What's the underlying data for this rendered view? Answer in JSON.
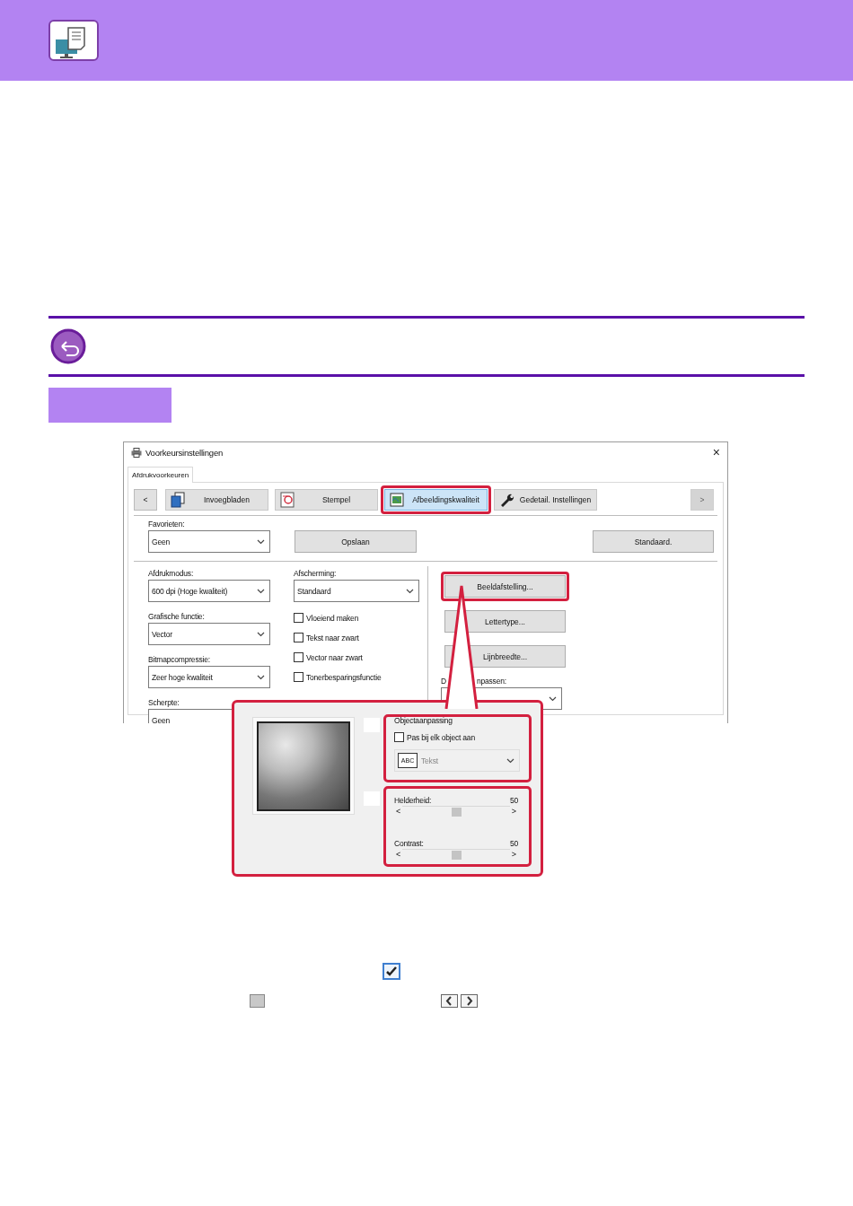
{
  "dialog": {
    "title": "Voorkeursinstellingen",
    "close": "×",
    "tabs": [
      {
        "label": "Afdrukvoorkeuren",
        "selected": true
      }
    ],
    "prev": {
      "label": "<",
      "disabled": false
    },
    "next": {
      "label": ">",
      "disabled": true
    },
    "categories": [
      {
        "label": "Invoegbladen",
        "kind": "pages",
        "selected": false,
        "highlighted": false
      },
      {
        "label": "Stempel",
        "kind": "stamp",
        "selected": false,
        "highlighted": false
      },
      {
        "label": "Afbeeldingskwaliteit",
        "kind": "picture",
        "selected": true,
        "highlighted": true
      },
      {
        "label": "Gedetail. Instellingen",
        "kind": "wrench",
        "selected": false,
        "highlighted": false
      }
    ],
    "favorites": {
      "label": "Favorieten:",
      "value": "Geen"
    },
    "save_button": "Opslaan",
    "default_button": "Standaard.",
    "selects": [
      {
        "label": "Afdrukmodus:",
        "value": "600 dpi (Hoge kwaliteit)"
      },
      {
        "label": "Grafische functie:",
        "value": "Vector"
      },
      {
        "label": "Bitmapcompressie:",
        "value": "Zeer hoge kwaliteit"
      },
      {
        "label": "Scherpte:",
        "value": "Geen"
      }
    ],
    "screening": {
      "label": "Afscherming:",
      "value": "Standaard"
    },
    "checkboxes": [
      {
        "label": "Vloeiend maken",
        "checked": false
      },
      {
        "label": "Tekst naar zwart",
        "checked": false
      },
      {
        "label": "Vector naar zwart",
        "checked": false
      },
      {
        "label": "Tonerbesparingsfunctie",
        "checked": false
      }
    ],
    "buttons": [
      {
        "label": "Beeldafstelling...",
        "highlighted": true
      },
      {
        "label": "Lettertype...",
        "highlighted": false
      },
      {
        "label": "Lijnbreedte...",
        "highlighted": false
      }
    ],
    "adjust_label": [
      "D",
      "npassen:"
    ]
  },
  "image_adjustment": {
    "object_group": {
      "title": "Objectaanpassing",
      "highlighted": true,
      "checkbox": {
        "label": "Pas bij elk object aan",
        "checked": false
      },
      "select": {
        "icon_text": "ABC",
        "value": "Tekst",
        "disabled": true
      }
    },
    "slider_group": {
      "highlighted": true,
      "sliders": [
        {
          "label": "Helderheid:",
          "reading": "50",
          "level": 0.5,
          "left": "<",
          "right": ">"
        },
        {
          "label": "Contrast:",
          "reading": "50",
          "level": 0.5,
          "left": "<",
          "right": ">"
        }
      ]
    }
  }
}
